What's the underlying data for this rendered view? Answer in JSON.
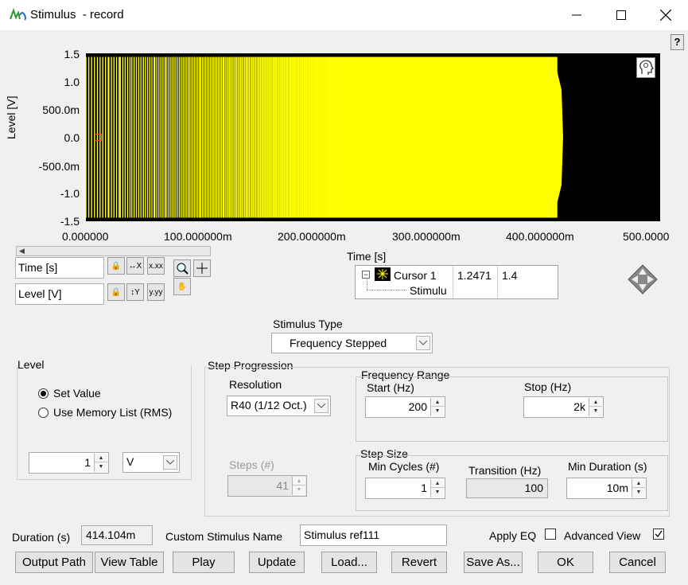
{
  "window": {
    "title": "Stimulus  - record",
    "help_label": "?"
  },
  "graph": {
    "y_axis_label": "Level [V]",
    "x_axis_label": "Time [s]",
    "y_ticks": [
      "1.5",
      "1.0",
      "500.0m",
      "0.0",
      "-500.0m",
      "-1.0",
      "-1.5"
    ],
    "x_ticks": [
      "0.000000",
      "100.000000m",
      "200.000000m",
      "300.000000m",
      "400.000000m",
      "500.0000"
    ],
    "waveform_color": "#ffff00",
    "background_color": "#000000",
    "signal_end_time": "414.104m"
  },
  "scale_controls": {
    "x_scale_label": "Time [s]",
    "y_scale_label": "Level [V]"
  },
  "cursor_legend": {
    "name": "Cursor 1",
    "x_value": "1.2471",
    "y_value": "1.4",
    "trace": "Stimulu"
  },
  "stimulus_type": {
    "label": "Stimulus Type",
    "value": "Frequency Stepped"
  },
  "level": {
    "group_label": "Level",
    "option_set_value": "Set Value",
    "option_memory_list": "Use Memory List (RMS)",
    "selected": "Set Value",
    "value": "1",
    "unit": "V"
  },
  "step_progression": {
    "group_label": "Step Progression",
    "resolution_label": "Resolution",
    "resolution_value": "R40 (1/12 Oct.)",
    "steps_label": "Steps (#)",
    "steps_value": "41",
    "frequency_range": {
      "label": "Frequency Range",
      "start_label": "Start (Hz)",
      "start_value": "200",
      "stop_label": "Stop (Hz)",
      "stop_value": "2k"
    },
    "step_size": {
      "label": "Step Size",
      "min_cycles_label": "Min Cycles (#)",
      "min_cycles_value": "1",
      "transition_label": "Transition (Hz)",
      "transition_value": "100",
      "min_duration_label": "Min Duration (s)",
      "min_duration_value": "10m"
    }
  },
  "footer": {
    "duration_label": "Duration (s)",
    "duration_value": "414.104m",
    "custom_name_label": "Custom Stimulus Name",
    "custom_name_value": "Stimulus ref111",
    "apply_eq_label": "Apply EQ",
    "apply_eq_checked": false,
    "advanced_view_label": "Advanced View",
    "advanced_view_checked": true
  },
  "buttons": {
    "output_path": "Output Path",
    "view_table": "View Table",
    "play": "Play",
    "update": "Update",
    "load": "Load...",
    "revert": "Revert",
    "save_as": "Save As...",
    "ok": "OK",
    "cancel": "Cancel"
  }
}
